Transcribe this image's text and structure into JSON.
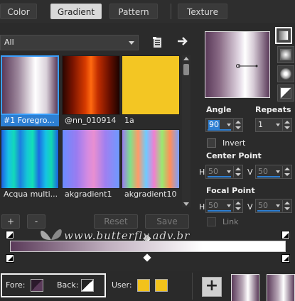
{
  "tabs": [
    {
      "label": "Color",
      "active": false
    },
    {
      "label": "Gradient",
      "active": true
    },
    {
      "label": "Pattern",
      "active": false
    },
    {
      "label": "Texture",
      "active": false
    }
  ],
  "filter": {
    "selected": "All"
  },
  "toolbar": {
    "browse_icon": "file-browse-icon",
    "arrow_icon": "right-arrow-icon"
  },
  "gradients": [
    {
      "label": "#1 Foregro...",
      "selected": true
    },
    {
      "label": "@nn_010914",
      "selected": false
    },
    {
      "label": "1a",
      "selected": false
    },
    {
      "label": "Acqua multi...",
      "selected": false
    },
    {
      "label": "akgradient1",
      "selected": false
    },
    {
      "label": "akgradient10",
      "selected": false
    }
  ],
  "buttons": {
    "add": "+",
    "remove": "-",
    "reset": "Reset",
    "save": "Save"
  },
  "settings": {
    "angle_label": "Angle",
    "angle_value": "90",
    "repeats_label": "Repeats",
    "repeats_value": "1",
    "invert_label": "Invert",
    "center_label": "Center Point",
    "center_h": "50",
    "center_v": "50",
    "focal_label": "Focal Point",
    "focal_h": "50",
    "focal_v": "50",
    "link_label": "Link",
    "h_label": "H",
    "v_label": "V"
  },
  "watermark": "www.butterfly.adv.br",
  "bottom": {
    "fore_label": "Fore:",
    "back_label": "Back:",
    "user_label": "User:",
    "add_label": "+"
  },
  "colors": {
    "accent": "#2d7fd3",
    "fore": "#5a3a59",
    "user1": "#f2c21b",
    "user2": "#f2c21b"
  }
}
